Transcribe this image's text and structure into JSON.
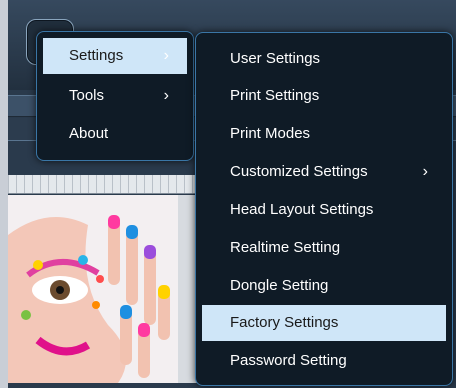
{
  "main_menu": {
    "items": [
      {
        "label": "Settings",
        "has_submenu": true,
        "selected": true
      },
      {
        "label": "Tools",
        "has_submenu": true,
        "selected": false
      },
      {
        "label": "About",
        "has_submenu": false,
        "selected": false
      }
    ],
    "arrow": "›"
  },
  "settings_submenu": {
    "items": [
      {
        "label": "User Settings"
      },
      {
        "label": "Print Settings"
      },
      {
        "label": "Print Modes"
      },
      {
        "label": "Customized Settings",
        "has_submenu": true
      },
      {
        "label": "Head Layout Settings"
      },
      {
        "label": "Realtime Setting"
      },
      {
        "label": "Dongle Setting"
      },
      {
        "label": "Factory Settings",
        "highlighted": true
      },
      {
        "label": "Password Setting"
      }
    ],
    "arrow": "›"
  },
  "colors": {
    "menu_bg": "#0f1b26",
    "menu_border": "#3a76a6",
    "highlight": "#cfe6f8",
    "text": "#ffffff"
  },
  "icons": {
    "app_menu_button": "menu-button",
    "submenu_arrow": "chevron-right-icon"
  }
}
